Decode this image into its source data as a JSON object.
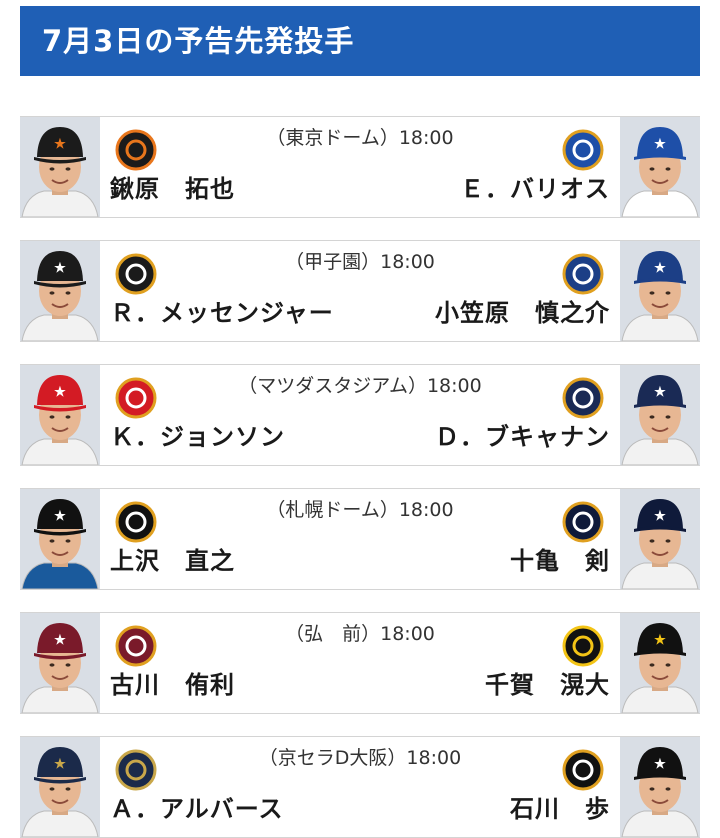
{
  "page_title": "7月3日の予告先発投手",
  "games": [
    {
      "venue": "（東京ドーム）18:00",
      "home": {
        "pitcher": "鍬原　拓也",
        "team_logo": "giants-logo",
        "cap_color": "#1b1b1b",
        "mark_color": "#e8761c",
        "shirt_color": "#f2f2f2"
      },
      "away": {
        "pitcher": "Ｅ．バリオス",
        "team_logo": "baystars-logo",
        "cap_color": "#1e4fa8",
        "mark_color": "#ffffff",
        "shirt_color": "#ffffff"
      }
    },
    {
      "venue": "（甲子園）18:00",
      "home": {
        "pitcher": "Ｒ．メッセンジャー",
        "team_logo": "tigers-logo",
        "cap_color": "#1b1b1b",
        "mark_color": "#ffffff",
        "shirt_color": "#f2f2f2"
      },
      "away": {
        "pitcher": "小笠原　慎之介",
        "team_logo": "dragons-logo",
        "cap_color": "#1c3f86",
        "mark_color": "#ffffff",
        "shirt_color": "#f2f2f2"
      }
    },
    {
      "venue": "（マツダスタジアム）18:00",
      "home": {
        "pitcher": "Ｋ．ジョンソン",
        "team_logo": "carp-logo",
        "cap_color": "#d31b24",
        "mark_color": "#ffffff",
        "shirt_color": "#f2f2f2"
      },
      "away": {
        "pitcher": "Ｄ．ブキャナン",
        "team_logo": "swallows-logo",
        "cap_color": "#1a2a55",
        "mark_color": "#ffffff",
        "shirt_color": "#f2f2f2"
      }
    },
    {
      "venue": "（札幌ドーム）18:00",
      "home": {
        "pitcher": "上沢　直之",
        "team_logo": "fighters-logo",
        "cap_color": "#111111",
        "mark_color": "#ffffff",
        "shirt_color": "#1a5a9c"
      },
      "away": {
        "pitcher": "十亀　剣",
        "team_logo": "lions-logo",
        "cap_color": "#0f1a3a",
        "mark_color": "#ffffff",
        "shirt_color": "#f2f2f2"
      }
    },
    {
      "venue": "（弘　前）18:00",
      "home": {
        "pitcher": "古川　侑利",
        "team_logo": "eagles-logo",
        "cap_color": "#7a1a2a",
        "mark_color": "#ffffff",
        "shirt_color": "#f2f2f2"
      },
      "away": {
        "pitcher": "千賀　滉大",
        "team_logo": "hawks-logo",
        "cap_color": "#111111",
        "mark_color": "#f3c416",
        "shirt_color": "#f2f2f2"
      }
    },
    {
      "venue": "（京セラD大阪）18:00",
      "home": {
        "pitcher": "Ａ．アルバース",
        "team_logo": "buffaloes-logo",
        "cap_color": "#1b2a4a",
        "mark_color": "#c9a74a",
        "shirt_color": "#f2f2f2"
      },
      "away": {
        "pitcher": "石川　歩",
        "team_logo": "marines-logo",
        "cap_color": "#111111",
        "mark_color": "#ffffff",
        "shirt_color": "#f2f2f2"
      }
    }
  ]
}
